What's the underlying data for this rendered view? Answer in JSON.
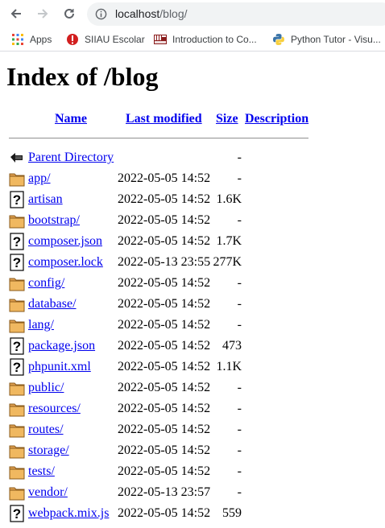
{
  "browser": {
    "url_host": "localhost",
    "url_path": "/blog/"
  },
  "bookmarks": [
    {
      "label": "Apps",
      "icon": "apps-grid-icon"
    },
    {
      "label": "SIIAU Escolar",
      "icon": "siiau-icon"
    },
    {
      "label": "Introduction to Co...",
      "icon": "mit-ocw-icon"
    },
    {
      "label": "Python Tutor - Visu...",
      "icon": "python-icon"
    }
  ],
  "page": {
    "title": "Index of /blog",
    "columns": {
      "name": "Name",
      "last_modified": "Last modified",
      "size": "Size",
      "description": "Description"
    },
    "parent": {
      "label": "Parent Directory",
      "size": "-"
    },
    "entries": [
      {
        "name": "app/",
        "modified": "2022-05-05 14:52",
        "size": "-",
        "type": "folder"
      },
      {
        "name": "artisan",
        "modified": "2022-05-05 14:52",
        "size": "1.6K",
        "type": "file"
      },
      {
        "name": "bootstrap/",
        "modified": "2022-05-05 14:52",
        "size": "-",
        "type": "folder"
      },
      {
        "name": "composer.json",
        "modified": "2022-05-05 14:52",
        "size": "1.7K",
        "type": "file"
      },
      {
        "name": "composer.lock",
        "modified": "2022-05-13 23:55",
        "size": "277K",
        "type": "file"
      },
      {
        "name": "config/",
        "modified": "2022-05-05 14:52",
        "size": "-",
        "type": "folder"
      },
      {
        "name": "database/",
        "modified": "2022-05-05 14:52",
        "size": "-",
        "type": "folder"
      },
      {
        "name": "lang/",
        "modified": "2022-05-05 14:52",
        "size": "-",
        "type": "folder"
      },
      {
        "name": "package.json",
        "modified": "2022-05-05 14:52",
        "size": "473",
        "type": "file"
      },
      {
        "name": "phpunit.xml",
        "modified": "2022-05-05 14:52",
        "size": "1.1K",
        "type": "file"
      },
      {
        "name": "public/",
        "modified": "2022-05-05 14:52",
        "size": "-",
        "type": "folder"
      },
      {
        "name": "resources/",
        "modified": "2022-05-05 14:52",
        "size": "-",
        "type": "folder"
      },
      {
        "name": "routes/",
        "modified": "2022-05-05 14:52",
        "size": "-",
        "type": "folder"
      },
      {
        "name": "storage/",
        "modified": "2022-05-05 14:52",
        "size": "-",
        "type": "folder"
      },
      {
        "name": "tests/",
        "modified": "2022-05-05 14:52",
        "size": "-",
        "type": "folder"
      },
      {
        "name": "vendor/",
        "modified": "2022-05-13 23:57",
        "size": "-",
        "type": "folder"
      },
      {
        "name": "webpack.mix.js",
        "modified": "2022-05-05 14:52",
        "size": "559",
        "type": "file"
      }
    ]
  }
}
